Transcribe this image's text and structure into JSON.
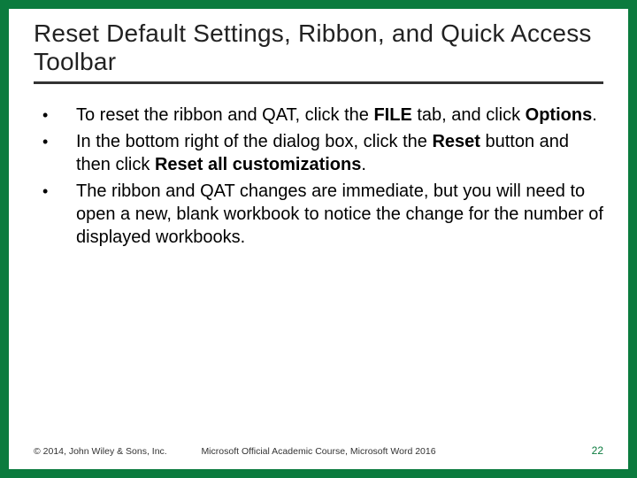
{
  "title": "Reset Default Settings, Ribbon, and Quick Access Toolbar",
  "bullets": [
    {
      "html": "To reset the ribbon and QAT, click the <b>FILE</b> tab, and click <b>Options</b>."
    },
    {
      "html": "In the bottom right of the dialog box, click the <b>Reset</b> button and then click <b>Reset all customizations</b>."
    },
    {
      "html": "The ribbon and QAT changes are immediate, but you will need to open a new, blank workbook to notice the change for the number of displayed workbooks."
    }
  ],
  "footer": {
    "left": "© 2014, John Wiley & Sons, Inc.",
    "center": "Microsoft Official Academic Course, Microsoft Word 2016",
    "page": "22"
  },
  "colors": {
    "brand_green": "#0b7b3e"
  }
}
